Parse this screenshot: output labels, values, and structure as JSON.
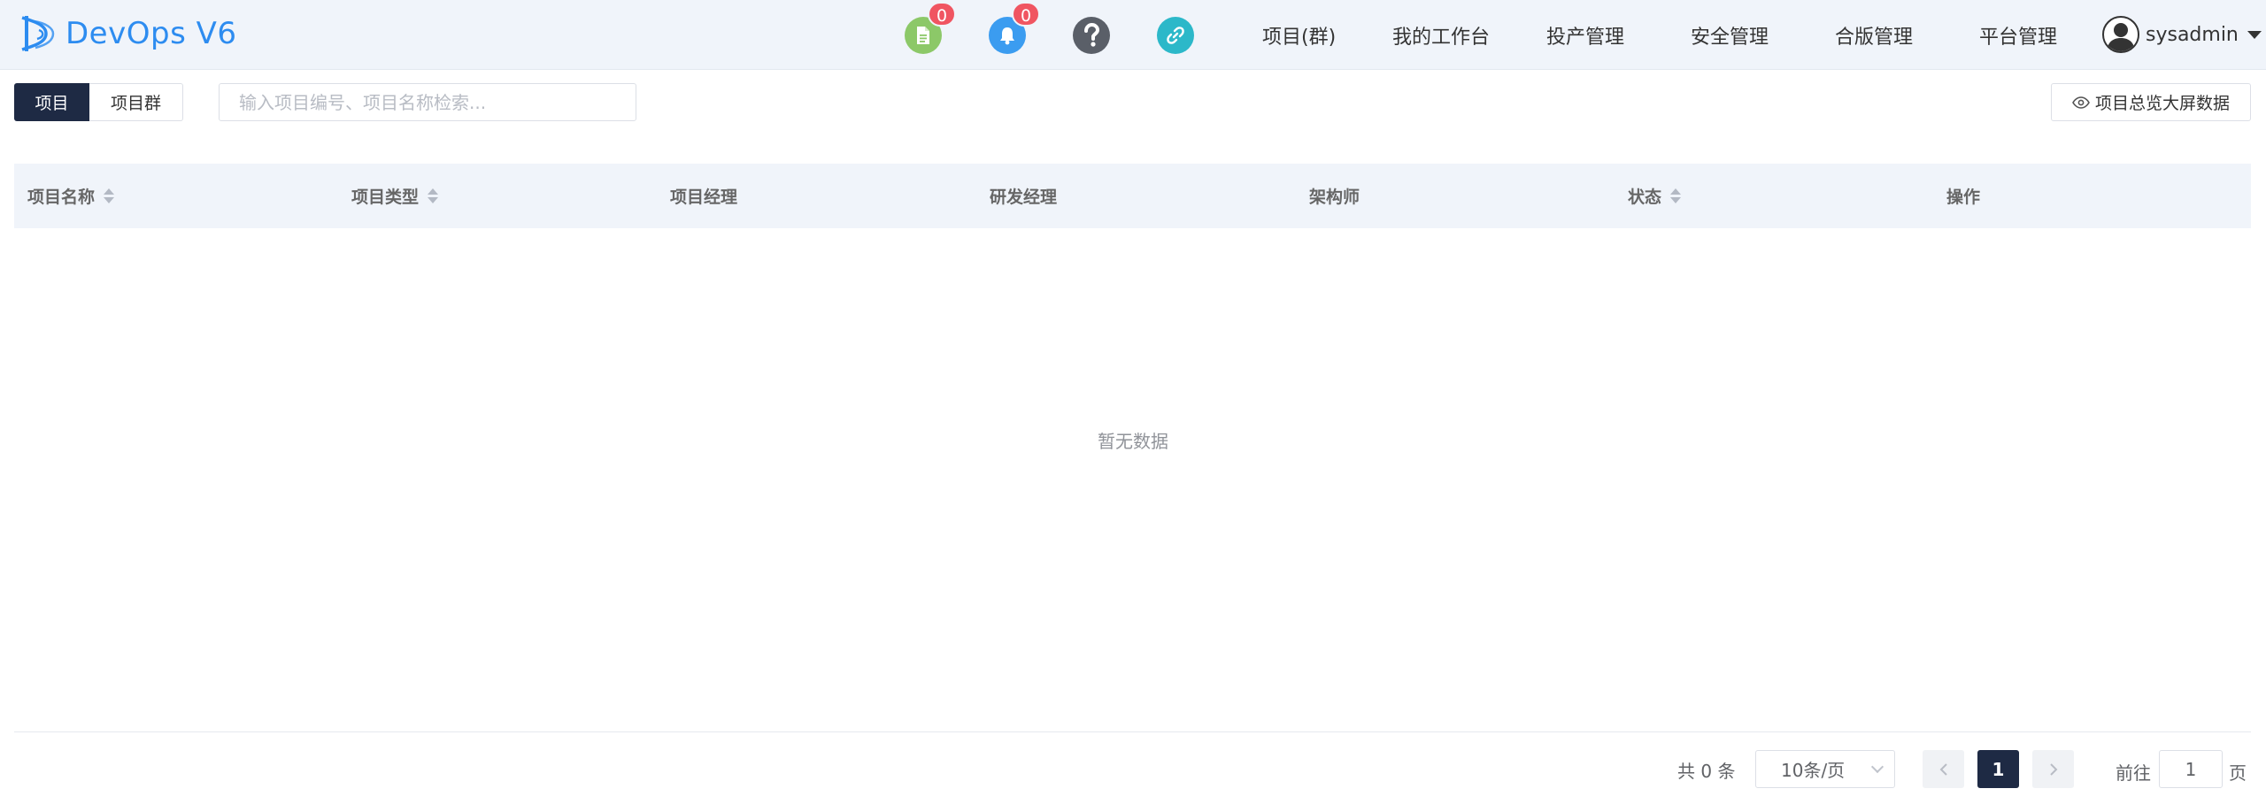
{
  "app": {
    "title": "DevOps V6"
  },
  "header": {
    "icons": [
      {
        "name": "document-icon",
        "color": "#8cc868",
        "badge": "0"
      },
      {
        "name": "bell-icon",
        "color": "#3b9cf0",
        "badge": "0"
      },
      {
        "name": "help-icon",
        "color": "#5a5f68"
      },
      {
        "name": "link-icon",
        "color": "#2cb8c9"
      }
    ],
    "nav": [
      "项目(群)",
      "我的工作台",
      "投产管理",
      "安全管理",
      "合版管理",
      "平台管理"
    ],
    "user": {
      "name": "sysadmin"
    }
  },
  "toolbar": {
    "tab_project": "项目",
    "tab_group": "项目群",
    "search_placeholder": "输入项目编号、项目名称检索...",
    "overview_button": "项目总览大屏数据"
  },
  "table": {
    "columns": [
      {
        "label": "项目名称",
        "sortable": true
      },
      {
        "label": "项目类型",
        "sortable": true
      },
      {
        "label": "项目经理",
        "sortable": false
      },
      {
        "label": "研发经理",
        "sortable": false
      },
      {
        "label": "架构师",
        "sortable": false
      },
      {
        "label": "状态",
        "sortable": true
      },
      {
        "label": "操作",
        "sortable": false
      }
    ],
    "empty_text": "暂无数据"
  },
  "pagination": {
    "total_text": "共 0 条",
    "page_size": "10条/页",
    "current_page": "1",
    "goto_label": "前往",
    "goto_value": "1",
    "goto_suffix": "页"
  },
  "colors": {
    "accent": "#2d8cf0",
    "dark": "#1e2a44",
    "badge": "#f05561"
  }
}
